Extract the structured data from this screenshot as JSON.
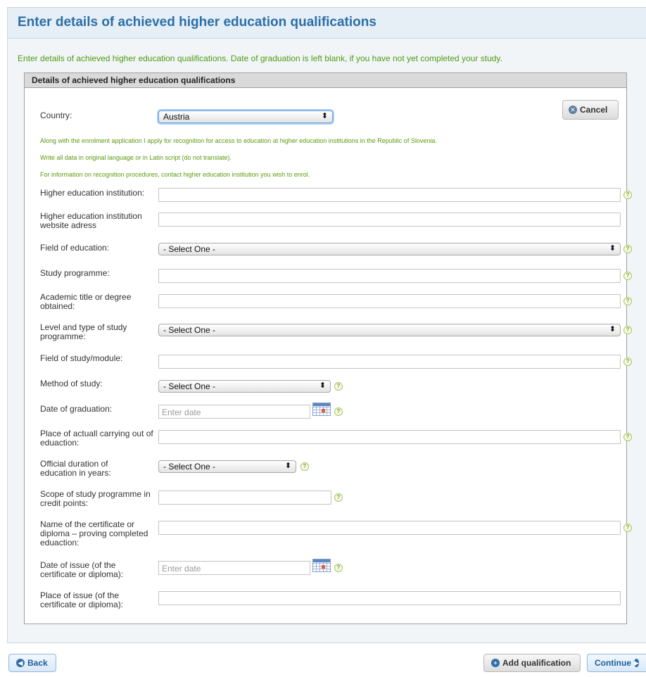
{
  "page": {
    "title": "Enter details of achieved higher education qualifications",
    "intro": "Enter details of achieved higher education qualifications. Date of graduation is left blank, if you have not yet completed your study."
  },
  "section": {
    "title": "Details of achieved higher education qualifications",
    "cancel_label": "Cancel",
    "notes": [
      "Along with the enrolment application I apply for recognition for access to education at higher education institutions in the Republic of Slovenia.",
      "Write all data in original language or in Latin script (do not translate).",
      "For information on recognition procedures, contact higher education institution you wish to enrol."
    ]
  },
  "form": {
    "country": {
      "label": "Country:",
      "value": "Austria"
    },
    "institution": {
      "label": "Higher education institution:"
    },
    "website": {
      "label": "Higher education institution website adress"
    },
    "field_of_education": {
      "label": "Field of education:",
      "value": "- Select One -"
    },
    "study_programme": {
      "label": "Study programme:"
    },
    "academic_title": {
      "label": "Academic title or degree obtained:"
    },
    "level_type": {
      "label": "Level and type of study programme:",
      "value": "- Select One -"
    },
    "field_module": {
      "label": "Field of study/module:"
    },
    "method": {
      "label": "Method of study:",
      "value": "- Select One -"
    },
    "graduation_date": {
      "label": "Date of graduation:",
      "placeholder": "Enter date"
    },
    "place_carrying": {
      "label": "Place of actuall carrying out of eduaction:"
    },
    "duration": {
      "label": "Official duration of education in years:",
      "value": "- Select One -"
    },
    "scope": {
      "label": "Scope of study programme in credit points:"
    },
    "certificate_name": {
      "label": "Name of the certificate or diploma – proving completed eduaction:"
    },
    "issue_date": {
      "label": "Date of issue (of the certificate or diploma):",
      "placeholder": "Enter date"
    },
    "issue_place": {
      "label": "Place of issue (of the certificate or diploma):"
    }
  },
  "footer": {
    "back_label": "Back",
    "add_label": "Add qualification",
    "continue_label": "Continue"
  },
  "icons": {
    "help": "question-circle-icon",
    "calendar": "calendar-icon",
    "cancel": "x-circle-icon",
    "add": "plus-circle-icon",
    "back": "arrow-left-circle-icon",
    "continue": "arrow-right-circle-icon"
  }
}
